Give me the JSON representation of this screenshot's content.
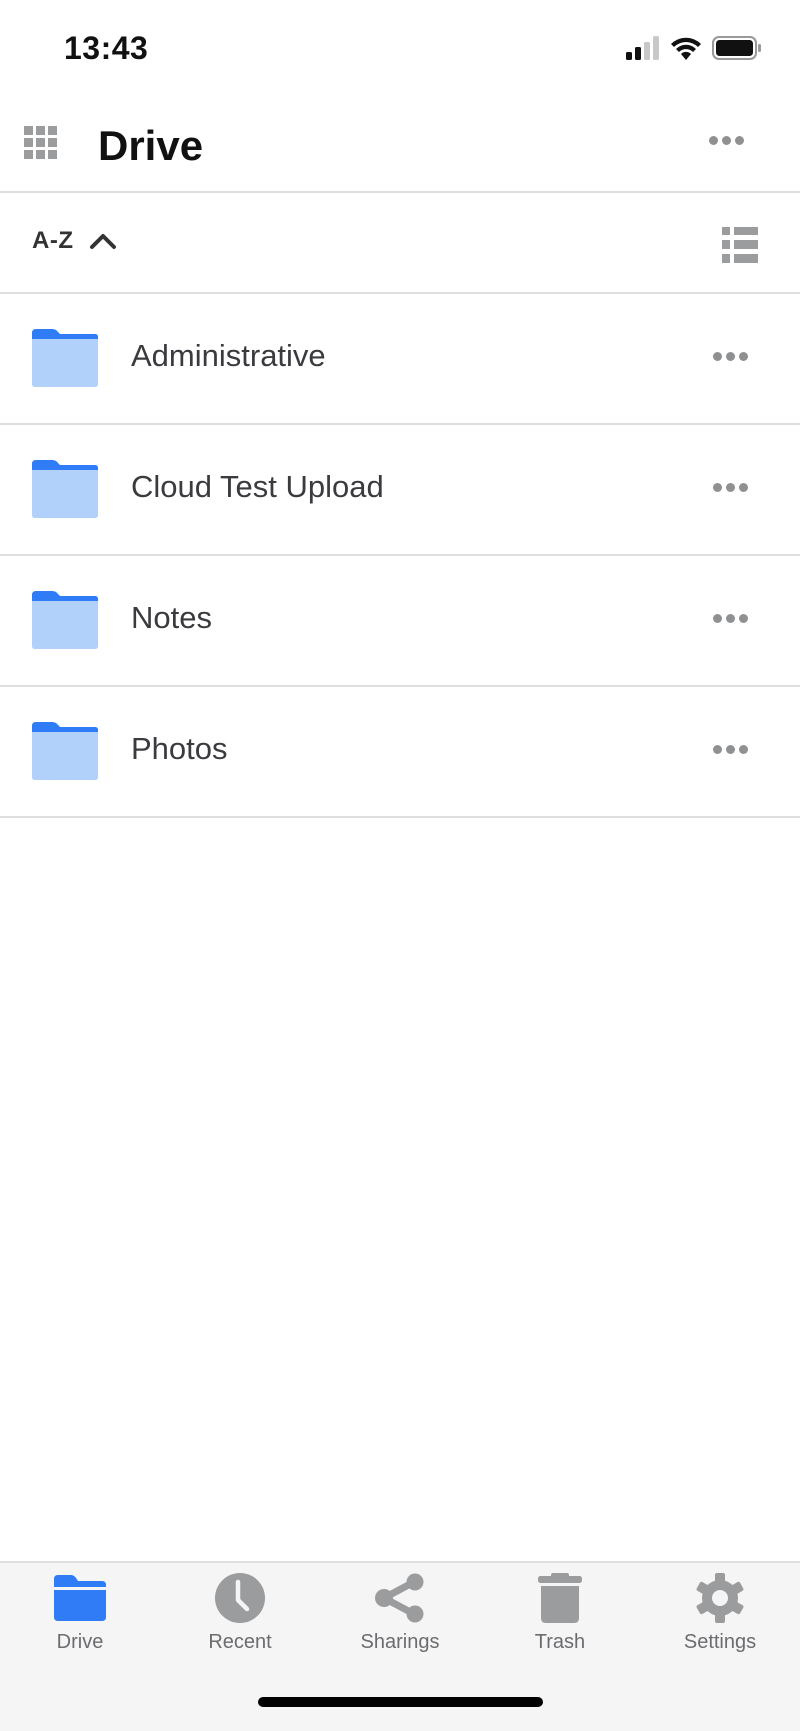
{
  "status_bar": {
    "time": "13:43",
    "icons": [
      "cellular-signal-icon",
      "wifi-icon",
      "battery-icon"
    ]
  },
  "header": {
    "title": "Drive",
    "left_icon": "apps-grid-icon",
    "right_icon": "more-horizontal-icon"
  },
  "sort_bar": {
    "label": "A-Z",
    "direction_icon": "chevron-up-icon",
    "view_icon": "list-view-icon"
  },
  "files": [
    {
      "name": "Administrative",
      "type": "folder"
    },
    {
      "name": "Cloud Test Upload",
      "type": "folder"
    },
    {
      "name": "Notes",
      "type": "folder"
    },
    {
      "name": "Photos",
      "type": "folder"
    }
  ],
  "tab_bar": {
    "active": "Drive",
    "items": [
      {
        "label": "Drive",
        "icon": "folder-icon"
      },
      {
        "label": "Recent",
        "icon": "clock-icon"
      },
      {
        "label": "Sharings",
        "icon": "share-icon"
      },
      {
        "label": "Trash",
        "icon": "trash-icon"
      },
      {
        "label": "Settings",
        "icon": "gear-icon"
      }
    ]
  },
  "colors": {
    "accent": "#2f7cf6",
    "folder_body": "#b1d1fb",
    "folder_tab": "#2f7cf6",
    "icon_gray": "#9b9c9e",
    "divider": "#dedede",
    "tab_bar_bg": "#f5f5f6"
  }
}
